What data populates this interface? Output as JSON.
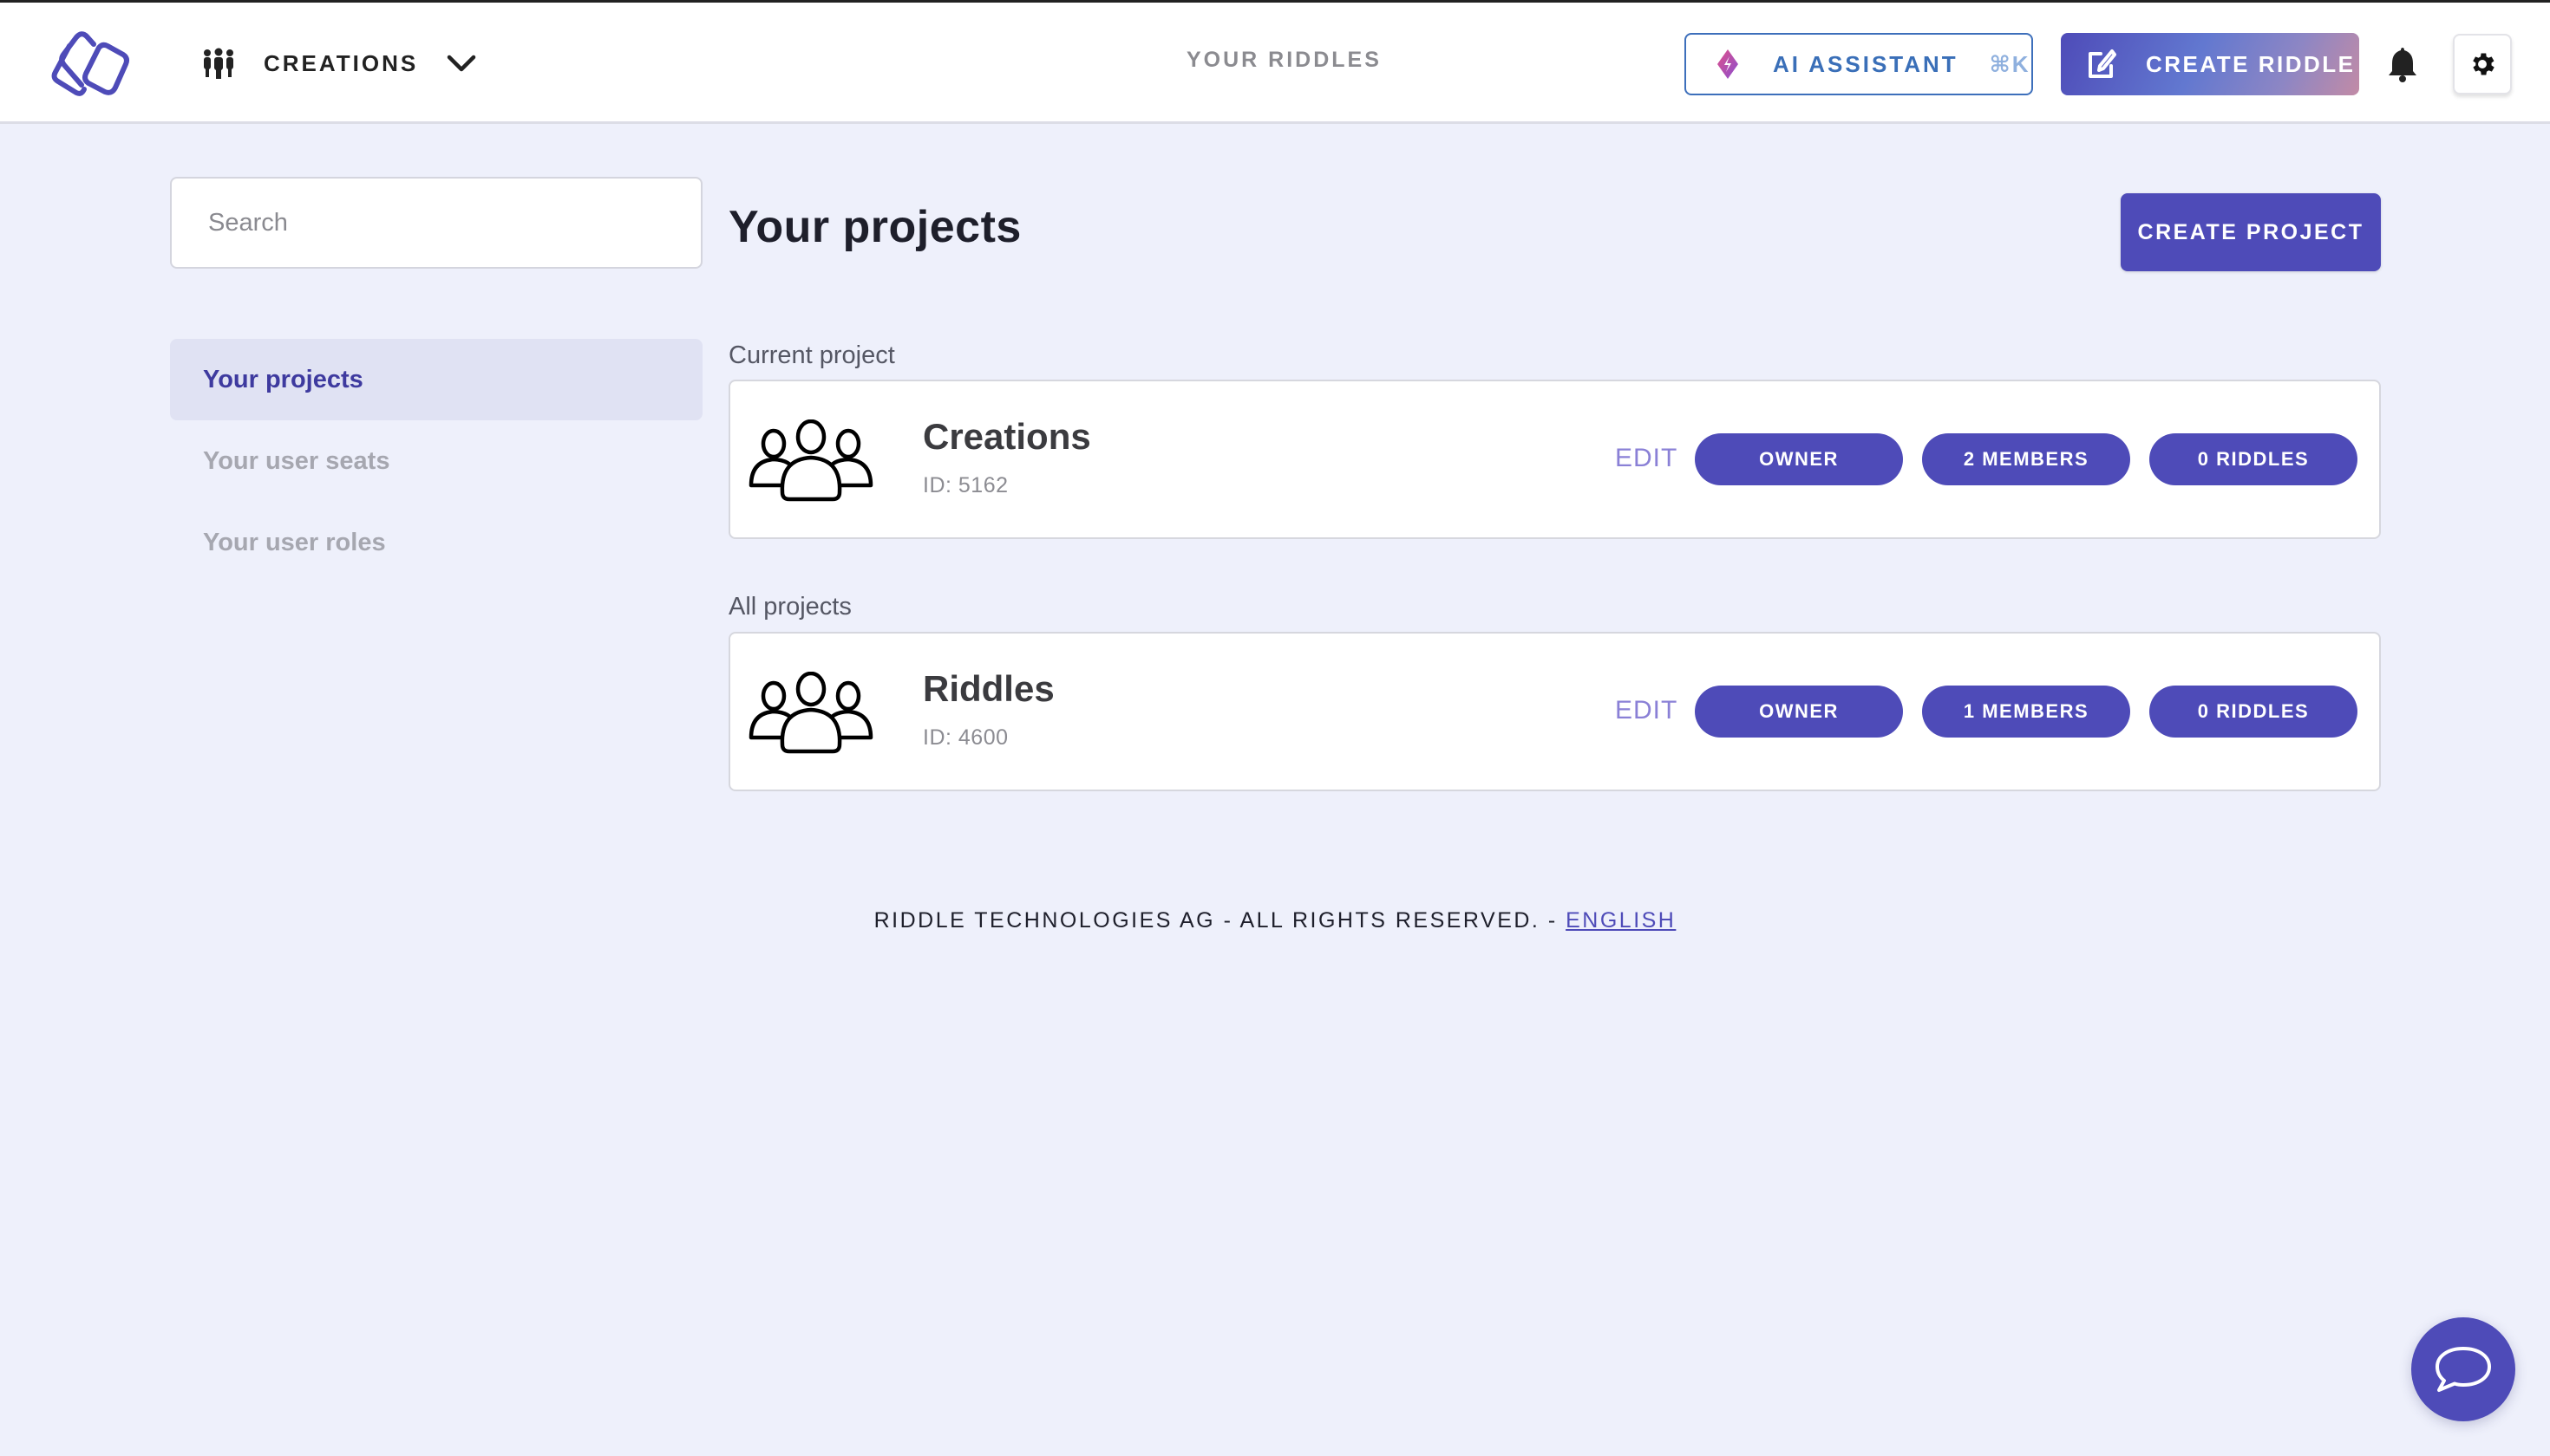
{
  "header": {
    "project_name": "CREATIONS",
    "nav_your_riddles": "YOUR RIDDLES",
    "ai_assistant_label": "AI ASSISTANT",
    "ai_assistant_shortcut": "⌘K",
    "create_riddle_label": "CREATE RIDDLE"
  },
  "sidebar": {
    "search_placeholder": "Search",
    "items": [
      {
        "label": "Your projects",
        "active": true
      },
      {
        "label": "Your user seats",
        "active": false
      },
      {
        "label": "Your user roles",
        "active": false
      }
    ]
  },
  "main": {
    "title": "Your projects",
    "create_project_label": "CREATE PROJECT",
    "current_section_label": "Current project",
    "all_section_label": "All projects",
    "current_project": {
      "name": "Creations",
      "id": "ID: 5162",
      "edit_label": "EDIT",
      "role": "OWNER",
      "members": "2 MEMBERS",
      "riddles": "0 RIDDLES"
    },
    "all_projects": [
      {
        "name": "Riddles",
        "id": "ID: 4600",
        "edit_label": "EDIT",
        "role": "OWNER",
        "members": "1 MEMBERS",
        "riddles": "0 RIDDLES"
      }
    ]
  },
  "footer": {
    "text": "RIDDLE TECHNOLOGIES AG - ALL RIGHTS RESERVED. - ",
    "language_link": "ENGLISH"
  },
  "colors": {
    "brand": "#4e4bb8",
    "background": "#eef0fb",
    "ai_blue": "#3a6fb8"
  }
}
